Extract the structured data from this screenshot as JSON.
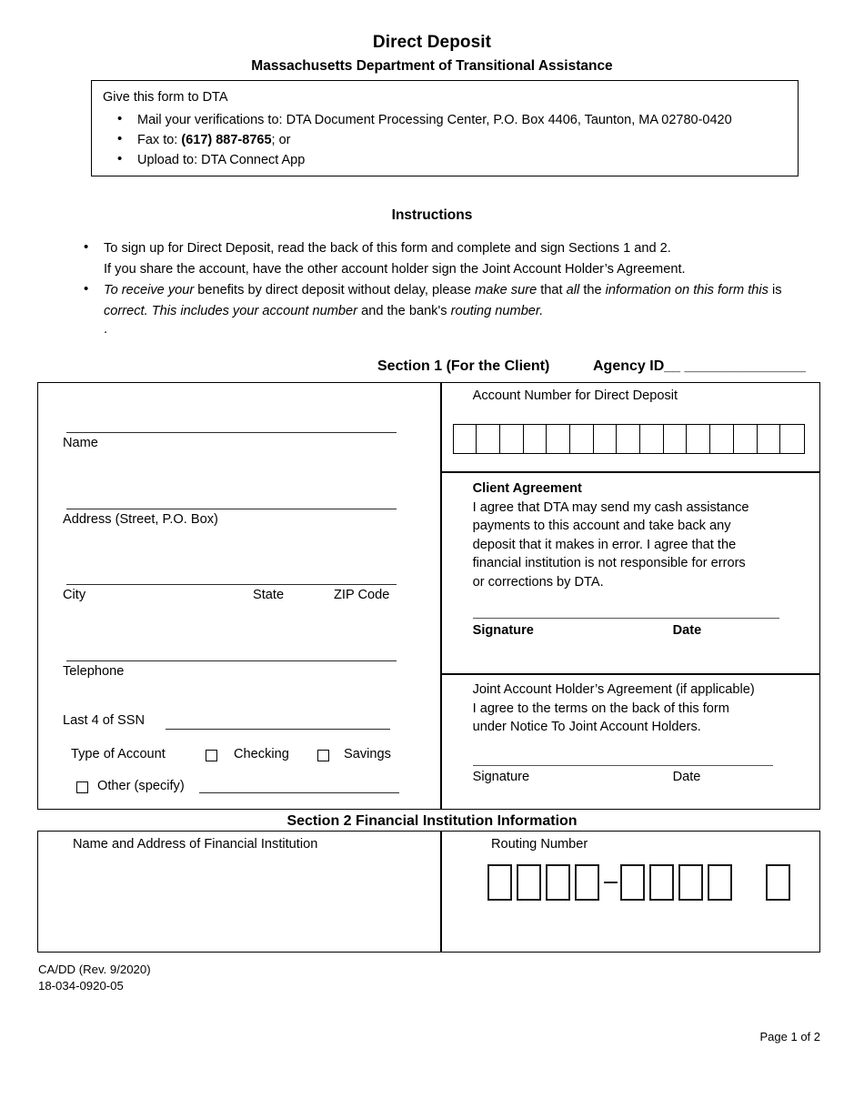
{
  "header": {
    "title": "Direct Deposit",
    "subtitle": "Massachusetts Department of Transitional Assistance"
  },
  "give_box": {
    "lead": "Give this form to DTA",
    "items": [
      {
        "pre": "Mail your verifications to: DTA Document Processing Center, P.O. Box 4406, Taunton, MA 02780-0420",
        "bold": "",
        "post": ""
      },
      {
        "pre": "Fax to: ",
        "bold": "(617) 887-8765",
        "post": "; or"
      },
      {
        "pre": "Upload to: DTA Connect App",
        "bold": "",
        "post": ""
      }
    ]
  },
  "instructions": {
    "title": "Instructions",
    "bullet1_line1": "To sign up for Direct Deposit, read the back of this form and complete and sign Sections 1 and 2.",
    "bullet1_line2": "If you share the account, have the other account holder sign the Joint Account Holder’s Agreement.",
    "bullet2_segments": [
      {
        "text": "To receive your",
        "italic": true
      },
      {
        "text": " benefits by direct deposit without delay, please ",
        "italic": false
      },
      {
        "text": "make sure",
        "italic": true
      },
      {
        "text": " that ",
        "italic": false
      },
      {
        "text": "all",
        "italic": true
      },
      {
        "text": " the ",
        "italic": false
      },
      {
        "text": "information on this form this",
        "italic": true
      },
      {
        "text": " is ",
        "italic": false
      },
      {
        "text": "correct.  This includes your account number",
        "italic": true
      },
      {
        "text": " and the bank's ",
        "italic": false
      },
      {
        "text": "routing number.",
        "italic": true
      }
    ],
    "trailing_dot": "."
  },
  "section1": {
    "title": "Section 1 (For the Client)",
    "agency_id": "Agency ID__ _______________",
    "left_fields": [
      {
        "label": "Name"
      },
      {
        "label": "Address (Street, P.O. Box)"
      },
      {
        "label": "City"
      },
      {
        "label": "State"
      },
      {
        "label": "ZIP Code"
      },
      {
        "label": "Telephone"
      }
    ],
    "ssn_label": "Last 4 of SSN",
    "account_type_label": "Type of Account",
    "checking_label": "Checking",
    "savings_label": "Savings",
    "other_label": "Other (specify)",
    "account_number": {
      "label": "Account Number for Direct Deposit",
      "cell_count": 15
    },
    "client_agreement": {
      "heading": "Client Agreement",
      "body": "I agree that DTA may send my cash assistance\npayments to this account and take back any\ndeposit that it makes in error.  I agree that the\nfinancial institution is not responsible for errors\nor corrections by DTA.",
      "signature_label": "Signature",
      "date_label": "Date"
    },
    "joint_agreement": {
      "heading": "Joint Account Holder’s Agreement (if applicable)",
      "body": "I agree to the terms on the back of this form\nunder Notice To Joint Account Holders.",
      "signature_label": "Signature",
      "date_label": "Date"
    }
  },
  "section2": {
    "title": "Section 2 Financial Institution Information",
    "fi_label": "Name and Address of Financial Institution",
    "routing_label": "Routing Number",
    "routing_groups": [
      4,
      4,
      1
    ],
    "routing_separator": "–"
  },
  "footer": {
    "form_code": "CA/DD (Rev. 9/2020)",
    "form_number": "18-034-0920-05",
    "page": "Page 1 of 2"
  }
}
